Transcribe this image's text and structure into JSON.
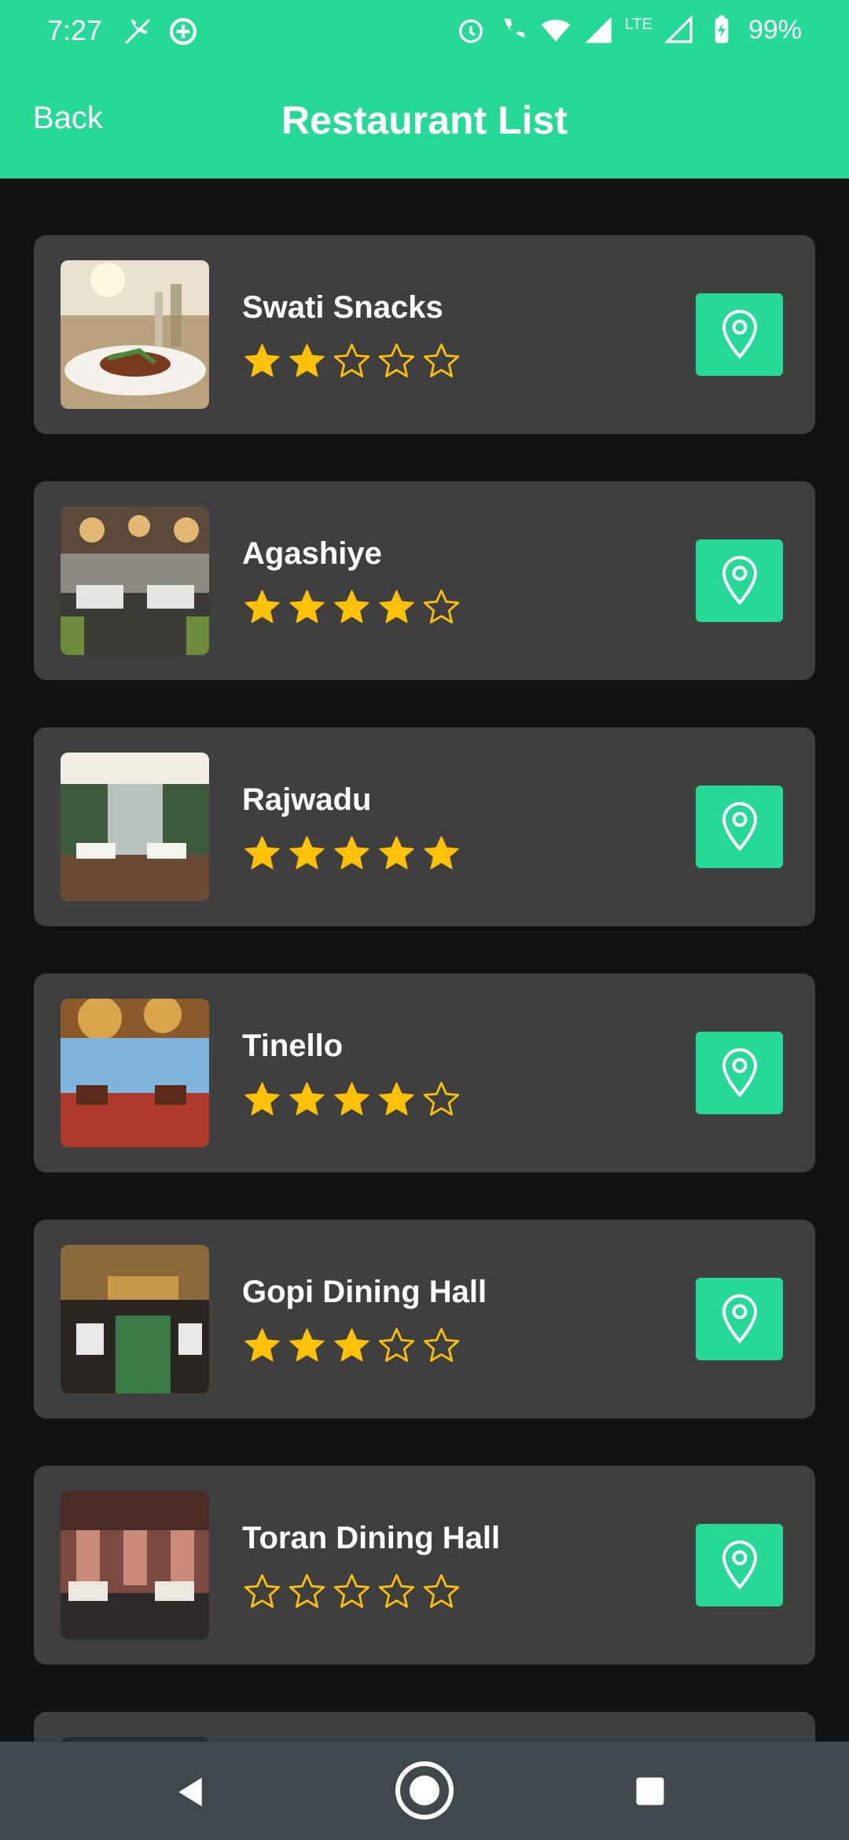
{
  "status_bar": {
    "time": "7:27",
    "battery": "99%",
    "network": "LTE",
    "icons_left": [
      "mute-call-icon",
      "data-saver-icon"
    ],
    "icons_right": [
      "alarm-icon",
      "wifi-calling-icon",
      "wifi-icon",
      "signal-icon",
      "signal-icon",
      "battery-charging-icon"
    ]
  },
  "app_bar": {
    "back_label": "Back",
    "title": "Restaurant List"
  },
  "theme": {
    "accent": "#26d996",
    "background": "#121212",
    "card": "#3f3f3f",
    "star": "#ffc107",
    "navbar": "#3f464c"
  },
  "restaurants": [
    {
      "name": "Swati Snacks",
      "rating": 2,
      "max_rating": 5,
      "image": "plated-dish-photo"
    },
    {
      "name": "Agashiye",
      "rating": 4,
      "max_rating": 5,
      "image": "dining-room-photo"
    },
    {
      "name": "Rajwadu",
      "rating": 5,
      "max_rating": 5,
      "image": "restaurant-interior-photo"
    },
    {
      "name": "Tinello",
      "rating": 4,
      "max_rating": 5,
      "image": "skyline-restaurant-photo"
    },
    {
      "name": "Gopi Dining Hall",
      "rating": 3,
      "max_rating": 5,
      "image": "cafe-interior-photo"
    },
    {
      "name": "Toran Dining Hall",
      "rating": 0,
      "max_rating": 5,
      "image": "banquet-hall-photo"
    }
  ],
  "nav_bar": {
    "icons": [
      "nav-back-icon",
      "nav-home-icon",
      "nav-recents-icon"
    ]
  }
}
